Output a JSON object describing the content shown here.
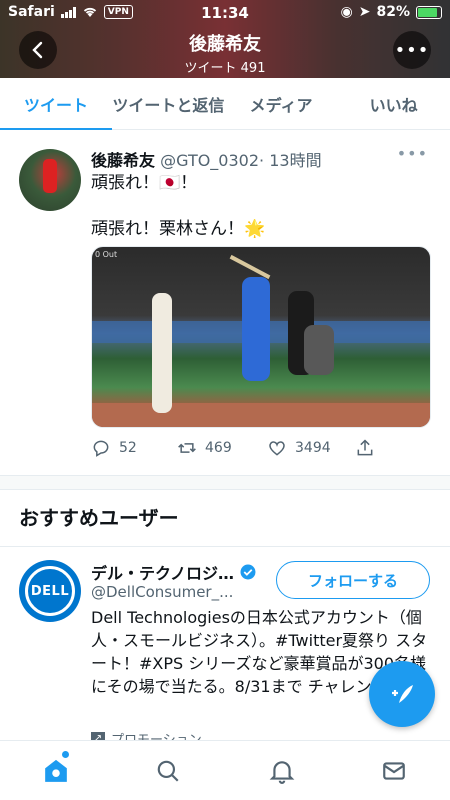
{
  "status_bar": {
    "carrier": "Safari",
    "vpn": "VPN",
    "time": "11:34",
    "battery": "82%"
  },
  "header": {
    "name": "後藤希友",
    "tweet_count": "ツイート 491"
  },
  "tabs": [
    {
      "label": "ツイート",
      "active": true
    },
    {
      "label": "ツイートと返信",
      "active": false
    },
    {
      "label": "メディア",
      "active": false
    },
    {
      "label": "いいね",
      "active": false
    }
  ],
  "tweet": {
    "name": "後藤希友",
    "handle": "@GTO_0302",
    "time": "· 13時間",
    "line1": "頑張れ！🇯🇵！",
    "line2": "頑張れ！栗林さん！🌟",
    "media_tag": "0 Out",
    "replies": "52",
    "retweets": "469",
    "likes": "3494"
  },
  "recommended": {
    "title": "おすすめユーザー",
    "user": {
      "logo_text": "DELL",
      "name": "デル・テクノロジ…",
      "handle": "@DellConsumer_...",
      "follow_label": "フォローする",
      "bio": "Dell Technologiesの日本公式アカウント（個人・スモールビジネス）。#Twitter夏祭り スタート！#XPS シリーズなど豪華賞品が300名様にその場で当たる。8/31まで チャレンジ🌻",
      "promo": "プロモーション"
    }
  },
  "colors": {
    "accent": "#1d9bf0",
    "dell": "#0076ce"
  }
}
